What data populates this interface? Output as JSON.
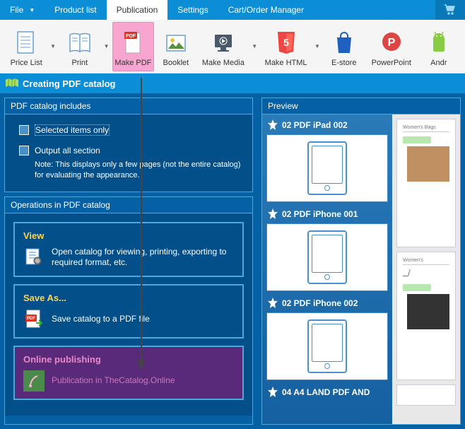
{
  "menu": {
    "items": [
      "File",
      "Product list",
      "Publication",
      "Settings",
      "Cart/Order Manager"
    ],
    "active": 2
  },
  "toolbar": [
    {
      "label": "Price List",
      "icon": "doc-lines",
      "dd": true
    },
    {
      "label": "Print",
      "icon": "book",
      "dd": true
    },
    {
      "label": "Make PDF",
      "icon": "pdf",
      "active": true
    },
    {
      "label": "Booklet",
      "icon": "pic"
    },
    {
      "label": "Make Media",
      "icon": "media",
      "dd": true,
      "wide": true
    },
    {
      "label": "Make HTML",
      "icon": "html5",
      "dd": true,
      "wide": true
    },
    {
      "label": "E-store",
      "icon": "bag"
    },
    {
      "label": "PowerPoint",
      "icon": "ppt",
      "wide": true
    },
    {
      "label": "Andr",
      "icon": "android"
    }
  ],
  "page_title": "Creating PDF catalog",
  "includes": {
    "title": "PDF catalog includes",
    "opt1": "Selected items only",
    "opt2": "Output all section",
    "note": "Note: This displays only a few pages (not the entire catalog) for evaluating the appearance."
  },
  "operations": {
    "title": "Operations in PDF catalog",
    "view": {
      "title": "View",
      "text": "Open catalog for viewing, printing, exporting to required format, etc."
    },
    "save": {
      "title": "Save As...",
      "text": "Save catalog to a PDF file"
    },
    "publish": {
      "title": "Online publishing",
      "text": "Publication in TheCatalog.Online"
    }
  },
  "preview": {
    "title": "Preview",
    "items": [
      "02 PDF iPad 002",
      "02 PDF iPhone 001",
      "02 PDF iPhone 002",
      "04 A4 LAND PDF AND"
    ],
    "doc_heading": "Women's Bags",
    "doc_label2": "Women's"
  }
}
